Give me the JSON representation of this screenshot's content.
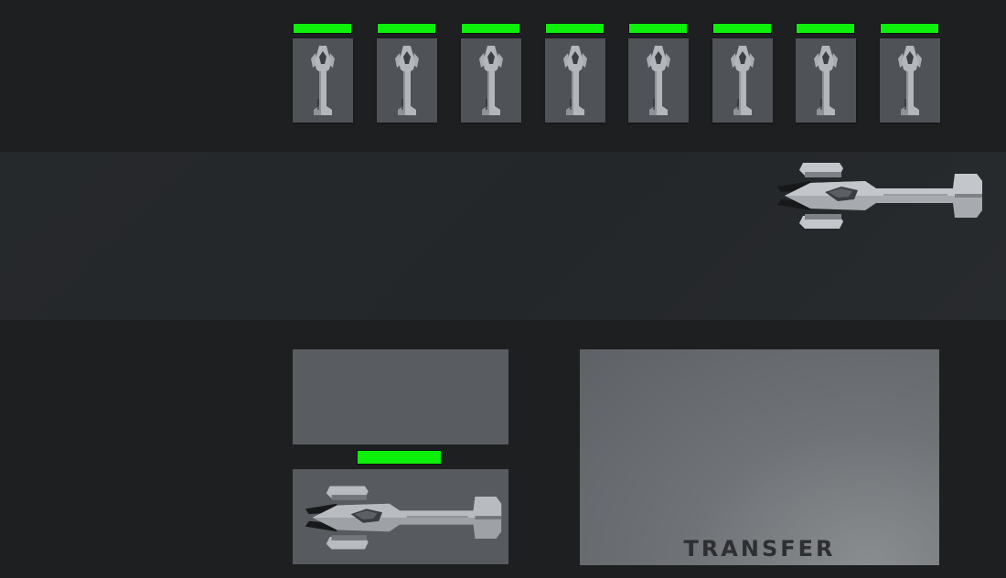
{
  "hangar": {
    "slots": [
      {
        "id": 1,
        "health": 1.0
      },
      {
        "id": 2,
        "health": 1.0
      },
      {
        "id": 3,
        "health": 1.0
      },
      {
        "id": 4,
        "health": 1.0
      },
      {
        "id": 5,
        "health": 1.0
      },
      {
        "id": 6,
        "health": 1.0
      },
      {
        "id": 7,
        "health": 1.0
      },
      {
        "id": 8,
        "health": 1.0
      }
    ]
  },
  "selected_ship": {
    "health": 1.0
  },
  "transfer": {
    "label": "TRANSFER"
  },
  "colors": {
    "background": "#1e1f21",
    "lane": "#25282b",
    "slot": "#4f5256",
    "health": "#0cf00c",
    "ship": "#b4b8bd",
    "transfer_text": "#2d2f32"
  },
  "icons": {
    "ship": "spaceship-icon"
  }
}
